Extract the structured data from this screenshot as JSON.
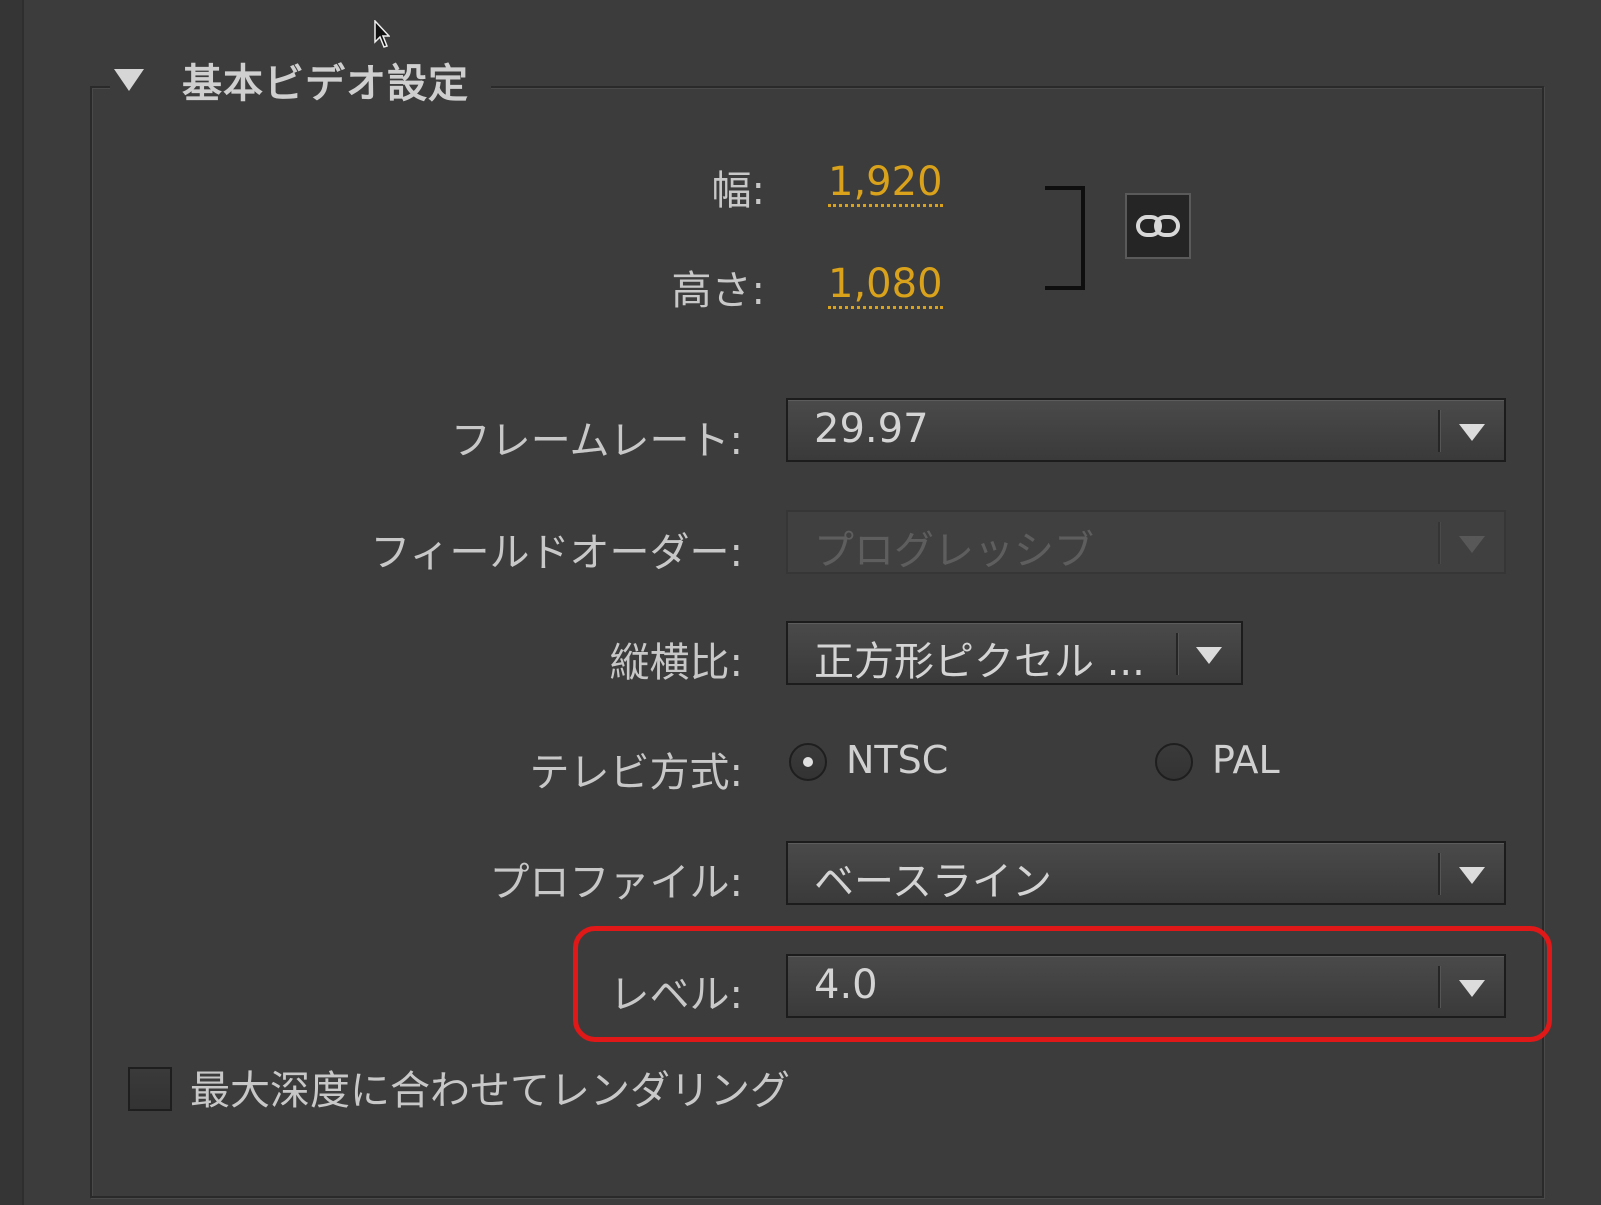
{
  "section": {
    "title": "基本ビデオ設定"
  },
  "dimensions": {
    "width_label": "幅:",
    "width_value": "1,920",
    "height_label": "高さ:",
    "height_value": "1,080"
  },
  "frame_rate": {
    "label": "フレームレート:",
    "value": "29.97"
  },
  "field_order": {
    "label": "フィールドオーダー:",
    "value": "プログレッシブ",
    "disabled": true
  },
  "aspect": {
    "label": "縦横比:",
    "value": "正方形ピクセル ..."
  },
  "tv_standard": {
    "label": "テレビ方式:",
    "options": [
      "NTSC",
      "PAL"
    ],
    "selected": "NTSC"
  },
  "profile": {
    "label": "プロファイル:",
    "value": "ベースライン"
  },
  "level": {
    "label": "レベル:",
    "value": "4.0"
  },
  "render_max_depth": {
    "label": "最大深度に合わせてレンダリング",
    "checked": false
  },
  "colors": {
    "background": "#3c3c3c",
    "link_value": "#d9a21a",
    "highlight": "#e01818"
  }
}
